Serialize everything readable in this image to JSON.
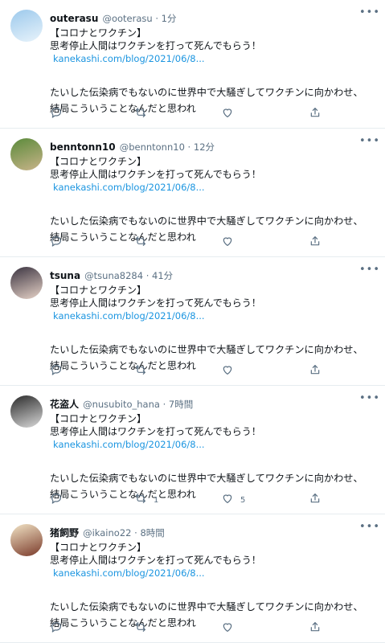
{
  "tweets": [
    {
      "display_name": "outerasu",
      "handle": "@ooterasu",
      "time": "1分",
      "lines": [
        "【コロナとワクチン】",
        "思考停止人間はワクチンを打って死んでもらう！"
      ],
      "link": "kanekashi.com/blog/2021/06/8...",
      "paragraph": "たいした伝染病でもないのに世界中で大騒ぎしてワクチンに向かわせ、結局こういうことなんだと思われ",
      "retweets": "",
      "likes": "",
      "avatar_colors": [
        "#9cc9ec",
        "#e8f3fb"
      ]
    },
    {
      "display_name": "benntonn10",
      "handle": "@benntonn10",
      "time": "12分",
      "lines": [
        "【コロナとワクチン】",
        "思考停止人間はワクチンを打って死んでもらう！"
      ],
      "link": "kanekashi.com/blog/2021/06/8...",
      "paragraph": "たいした伝染病でもないのに世界中で大騒ぎしてワクチンに向かわせ、結局こういうことなんだと思われ",
      "retweets": "",
      "likes": "",
      "avatar_colors": [
        "#5a8a3a",
        "#c9b48a"
      ]
    },
    {
      "display_name": "tsuna",
      "handle": "@tsuna8284",
      "time": "41分",
      "lines": [
        "【コロナとワクチン】",
        "思考停止人間はワクチンを打って死んでもらう！"
      ],
      "link": "kanekashi.com/blog/2021/06/8...",
      "paragraph": "たいした伝染病でもないのに世界中で大騒ぎしてワクチンに向かわせ、結局こういうことなんだと思われ",
      "retweets": "",
      "likes": "",
      "avatar_colors": [
        "#3a3340",
        "#e7d3c8"
      ]
    },
    {
      "display_name": "花盗人",
      "handle": "@nusubito_hana",
      "time": "7時間",
      "lines": [
        "【コロナとワクチン】",
        "思考停止人間はワクチンを打って死んでもらう！"
      ],
      "link": "kanekashi.com/blog/2021/06/8...",
      "paragraph": "たいした伝染病でもないのに世界中で大騒ぎしてワクチンに向かわせ、結局こういうことなんだと思われ",
      "retweets": "1",
      "likes": "5",
      "avatar_colors": [
        "#2a2a2a",
        "#d9d9d9"
      ]
    },
    {
      "display_name": "猪飼野",
      "handle": "@ikaino22",
      "time": "8時間",
      "lines": [
        "【コロナとワクチン】",
        "思考停止人間はワクチンを打って死んでもらう！"
      ],
      "link": "kanekashi.com/blog/2021/06/8...",
      "paragraph": "たいした伝染病でもないのに世界中で大騒ぎしてワクチンに向かわせ、結局こういうことなんだと思われ",
      "retweets": "",
      "likes": "",
      "avatar_colors": [
        "#f2e4c6",
        "#7a3a2a"
      ]
    }
  ],
  "icons": {
    "more": "more-icon",
    "reply": "reply-icon",
    "retweet": "retweet-icon",
    "like": "like-icon",
    "share": "share-icon"
  },
  "colors": {
    "link": "#1b95e0",
    "secondary": "#5b7083",
    "divider": "#e6ecf0"
  }
}
